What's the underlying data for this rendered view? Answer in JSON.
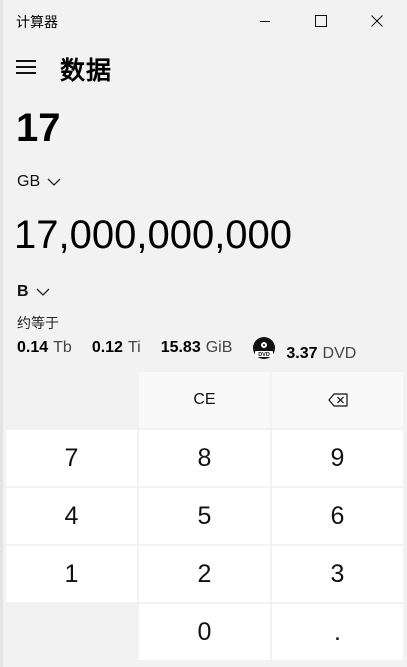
{
  "window": {
    "app_title": "计算器"
  },
  "header": {
    "title": "数据"
  },
  "converter": {
    "from_value": "17",
    "from_unit": "GB",
    "to_value": "17,000,000,000",
    "to_unit": "B",
    "about_label": "约等于",
    "equivalents": [
      {
        "value": "0.14",
        "unit": "Tb"
      },
      {
        "value": "0.12",
        "unit": "Ti"
      },
      {
        "value": "15.83",
        "unit": "GiB"
      },
      {
        "value": "3.37",
        "unit": "DVD",
        "icon": "dvd-icon"
      }
    ]
  },
  "keypad": {
    "ce": "CE",
    "backspace_icon": "backspace-icon",
    "digits": {
      "k7": "7",
      "k8": "8",
      "k9": "9",
      "k4": "4",
      "k5": "5",
      "k6": "6",
      "k1": "1",
      "k2": "2",
      "k3": "3",
      "k0": "0",
      "decimal": "."
    }
  }
}
